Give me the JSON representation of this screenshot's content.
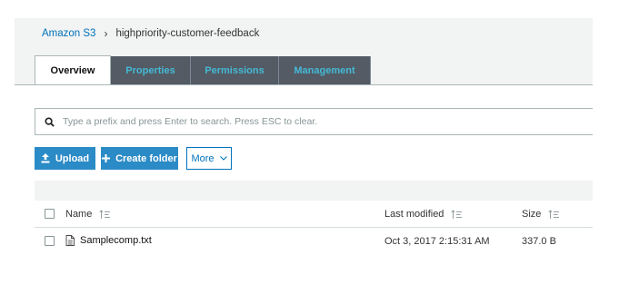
{
  "breadcrumb": {
    "root": "Amazon S3",
    "separator": "›",
    "current": "highpriority-customer-feedback"
  },
  "tabs": [
    {
      "label": "Overview",
      "active": true
    },
    {
      "label": "Properties",
      "active": false
    },
    {
      "label": "Permissions",
      "active": false
    },
    {
      "label": "Management",
      "active": false
    }
  ],
  "search": {
    "icon": "search-icon",
    "placeholder": "Type a prefix and press Enter to search. Press ESC to clear."
  },
  "actions": {
    "upload_label": "Upload",
    "create_folder_label": "Create folder",
    "more_label": "More",
    "accent": "#2b8bc6"
  },
  "table": {
    "columns": {
      "name": "Name",
      "last_modified": "Last modified",
      "size": "Size"
    },
    "rows": [
      {
        "name": "Samplecomp.txt",
        "last_modified": "Oct 3, 2017 2:15:31 AM",
        "size": "337.0 B",
        "icon": "file-icon"
      }
    ]
  }
}
